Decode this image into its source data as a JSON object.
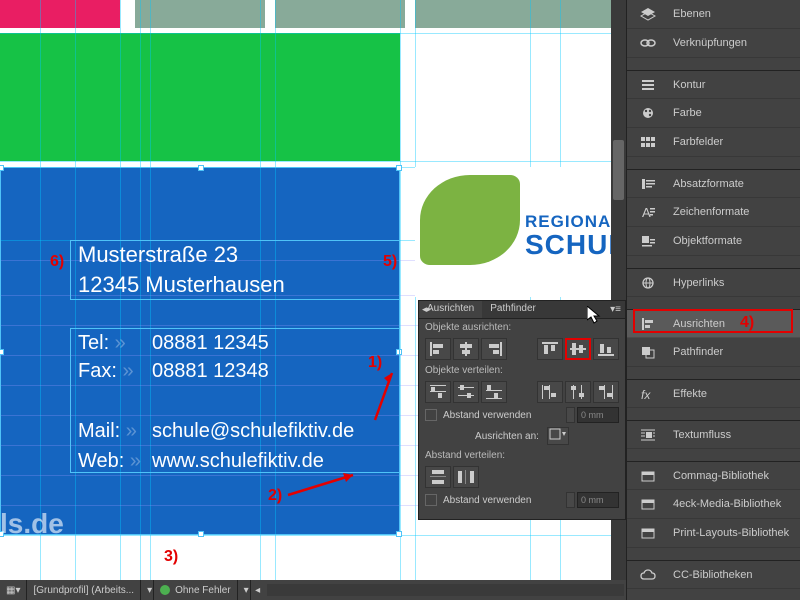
{
  "canvas": {
    "address_line1": "Musterstraße 23",
    "address_line2": "12345 Musterhausen",
    "tel_label": "Tel:",
    "tel_value": "08881 12345",
    "fax_label": "Fax:",
    "fax_value": "08881 12348",
    "mail_label": "Mail:",
    "mail_value": "schule@schulefiktiv.de",
    "web_label": "Web:",
    "web_value": "www.schulefiktiv.de",
    "logo_line1": "REGIONAL",
    "logo_line2": "SCHULE",
    "ls_de": "ls.de"
  },
  "markers": {
    "m1": "1)",
    "m2": "2)",
    "m3": "3)",
    "m4": "4)",
    "m5": "5)",
    "m6": "6)"
  },
  "right_panel": [
    {
      "label": "Ebenen",
      "icon": "layers"
    },
    {
      "label": "Verknüpfungen",
      "icon": "links"
    },
    {
      "label": "Kontur",
      "icon": "stroke",
      "sep": true
    },
    {
      "label": "Farbe",
      "icon": "color"
    },
    {
      "label": "Farbfelder",
      "icon": "swatches"
    },
    {
      "label": "Absatzformate",
      "icon": "para",
      "sep": true
    },
    {
      "label": "Zeichenformate",
      "icon": "char"
    },
    {
      "label": "Objektformate",
      "icon": "obj"
    },
    {
      "label": "Hyperlinks",
      "icon": "hyper",
      "sep": true
    },
    {
      "label": "Ausrichten",
      "icon": "align",
      "sep": true,
      "hl": true
    },
    {
      "label": "Pathfinder",
      "icon": "pathfinder"
    },
    {
      "label": "Effekte",
      "icon": "fx",
      "sep": true
    },
    {
      "label": "Textumfluss",
      "icon": "wrap",
      "sep": true
    },
    {
      "label": "Commag-Bibliothek",
      "icon": "lib",
      "sep": true
    },
    {
      "label": "4eck-Media-Bibliothek",
      "icon": "lib"
    },
    {
      "label": "Print-Layouts-Bibliothek",
      "icon": "lib"
    },
    {
      "label": "CC-Bibliotheken",
      "icon": "cc",
      "sep": true
    }
  ],
  "align_panel": {
    "tab_align": "Ausrichten",
    "tab_pathfinder": "Pathfinder",
    "sec_align_objects": "Objekte ausrichten:",
    "sec_distribute_objects": "Objekte verteilen:",
    "chk_use_spacing": "Abstand verwenden",
    "spacing_value": "0 mm",
    "sec_align_to": "Ausrichten an:",
    "sec_distribute_spacing": "Abstand verteilen:"
  },
  "status_bar": {
    "profile": "[Grundprofil] (Arbeits...",
    "no_errors": "Ohne Fehler"
  }
}
